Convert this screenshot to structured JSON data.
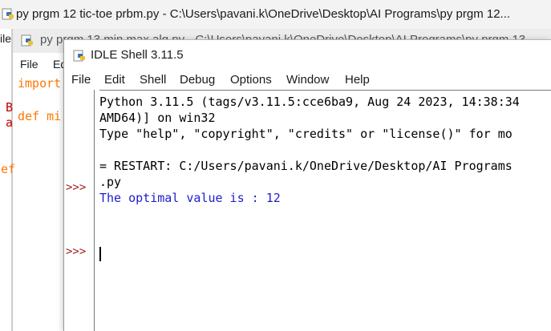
{
  "back_window_1": {
    "title": "py prgm 12 tic-toe prbm.py - C:\\Users\\pavani.k\\OneDrive\\Desktop\\AI Programs\\py prgm 12..."
  },
  "back_window_2": {
    "title": "py prgm 13 min max alg.py - C:\\Users\\pavani.k\\OneDrive\\Desktop\\AI Programs\\py prgm 13",
    "menu": [
      "File",
      "Ed"
    ],
    "code_fragments": {
      "import": "import",
      "def": "def mi",
      "b": "B",
      "a": "a",
      "ef": "ef"
    },
    "colors": {
      "keyword": "#ff7700",
      "def_name": "#0000ff",
      "error": "#c00000"
    }
  },
  "idle_shell": {
    "title": "IDLE Shell 3.11.5",
    "menu": [
      "File",
      "Edit",
      "Shell",
      "Debug",
      "Options",
      "Window",
      "Help"
    ],
    "prompts": [
      ">>>",
      ">>>"
    ],
    "lines": [
      "Python 3.11.5 (tags/v3.11.5:cce6ba9, Aug 24 2023, 14:38:34",
      "AMD64)] on win32",
      "Type \"help\", \"copyright\", \"credits\" or \"license()\" for mo",
      "= RESTART: C:/Users/pavani.k/OneDrive/Desktop/AI Programs",
      ".py",
      "The optimal value is : 12"
    ],
    "colors": {
      "prompt": "#9b1c1c",
      "output": "#1d1dcc"
    }
  }
}
